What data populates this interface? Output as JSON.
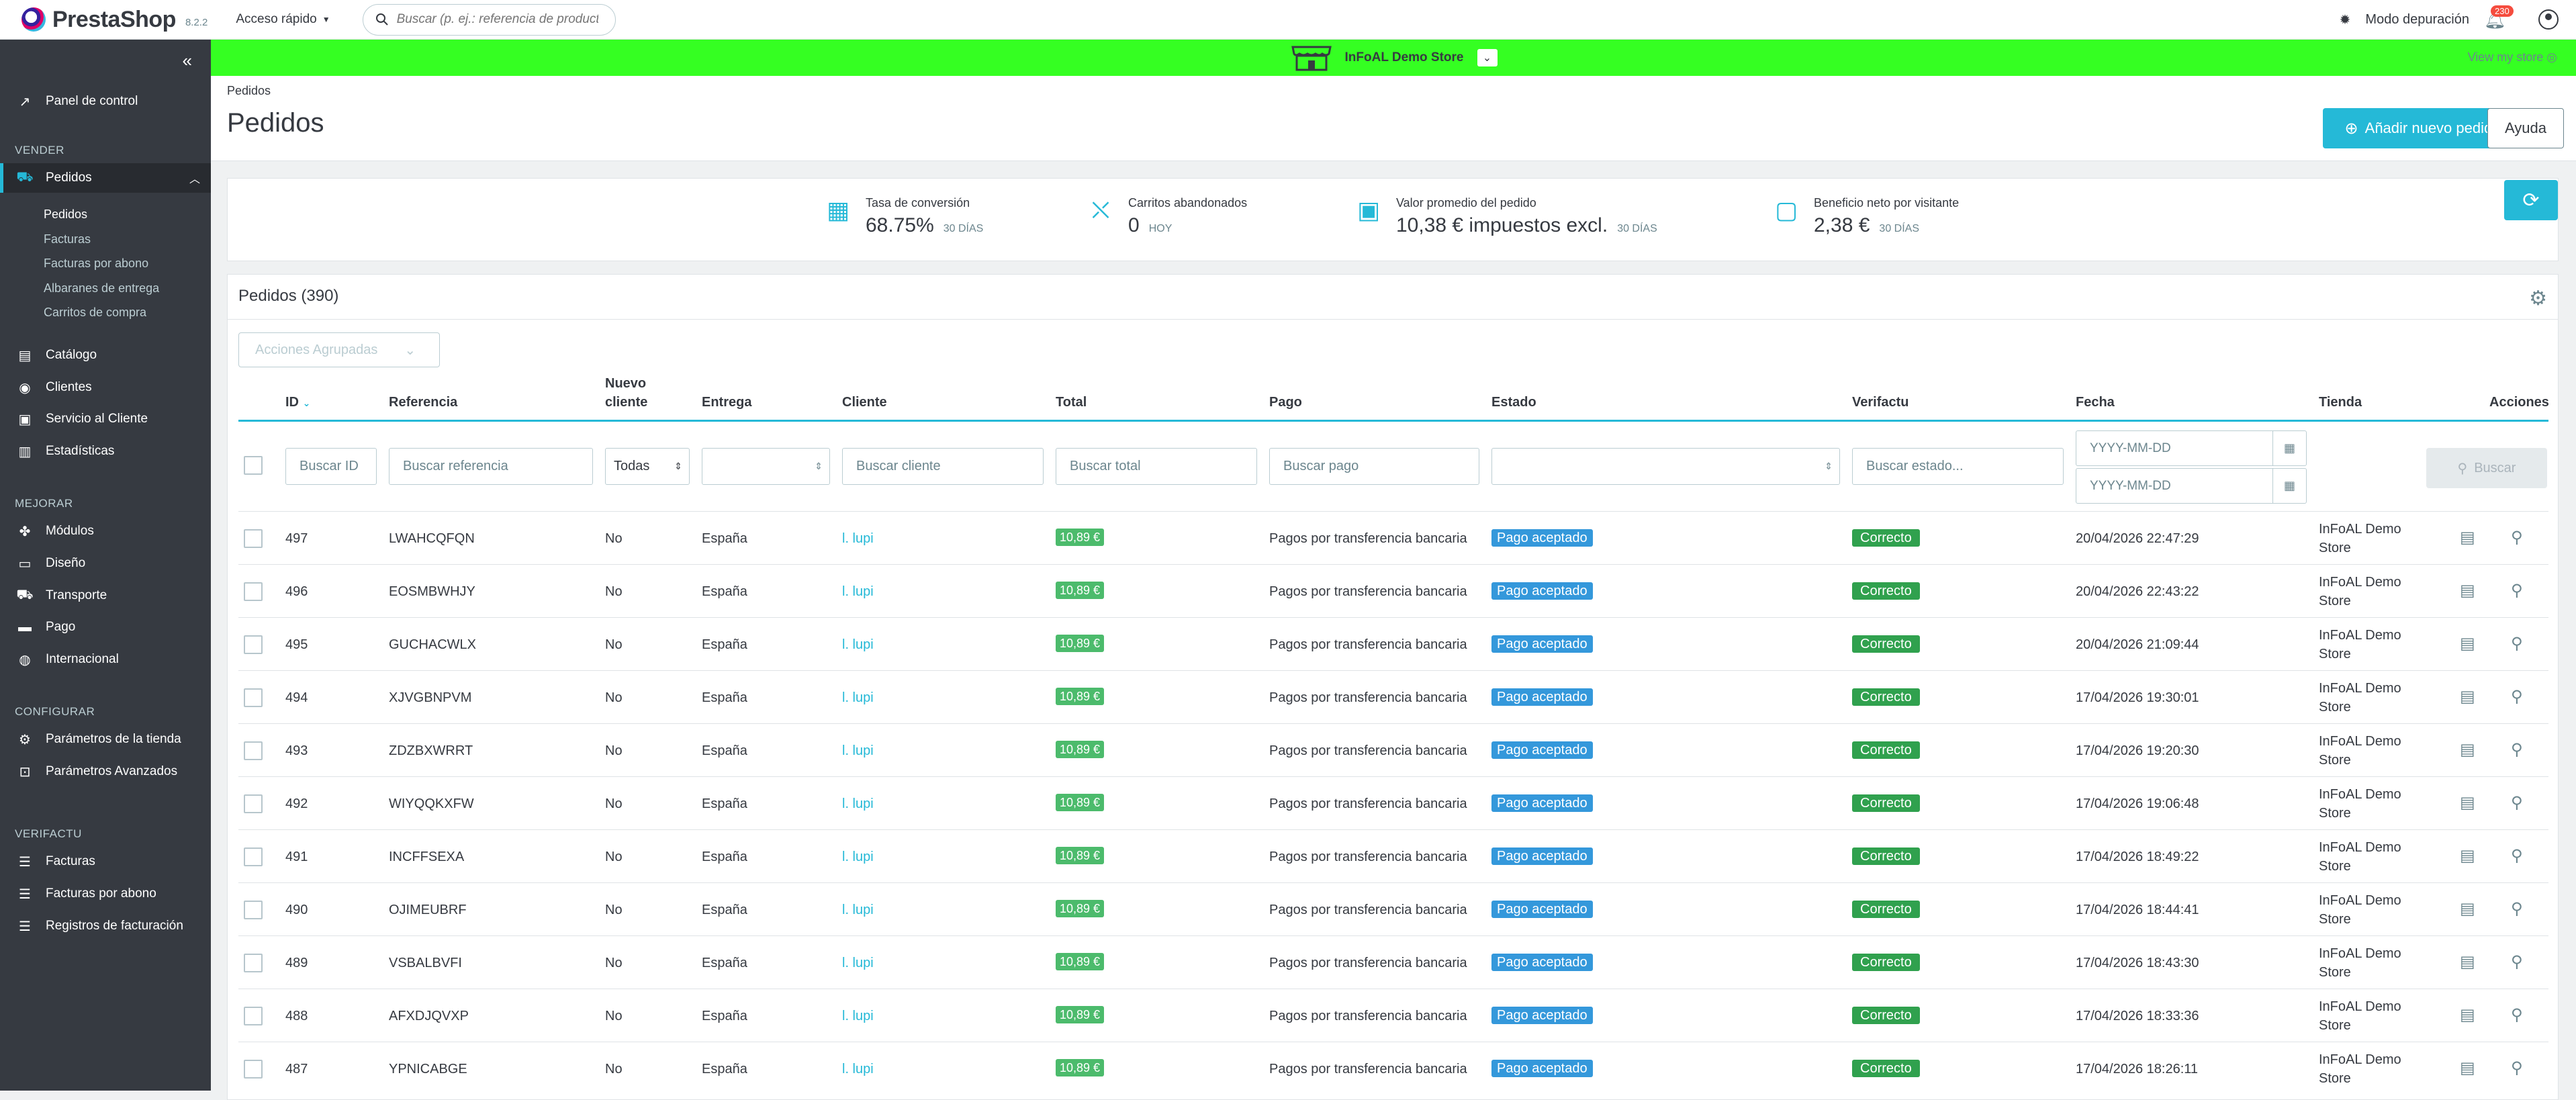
{
  "top": {
    "logo_text": "PrestaShop",
    "version": "8.2.2",
    "quick_access": "Acceso rápido",
    "search_placeholder": "Buscar (p. ej.: referencia de producto, ...",
    "debug_mode": "Modo depuración",
    "notif_count": "230"
  },
  "sidebar": {
    "panel": "Panel de control",
    "sec_sell": "VENDER",
    "orders": "Pedidos",
    "orders_sub": [
      "Pedidos",
      "Facturas",
      "Facturas por abono",
      "Albaranes de entrega",
      "Carritos de compra"
    ],
    "catalog": "Catálogo",
    "customers": "Clientes",
    "service": "Servicio al Cliente",
    "stats": "Estadísticas",
    "sec_improve": "MEJORAR",
    "modules": "Módulos",
    "design": "Diseño",
    "shipping": "Transporte",
    "payment": "Pago",
    "intl": "Internacional",
    "sec_config": "CONFIGURAR",
    "shop_params": "Parámetros de la tienda",
    "adv_params": "Parámetros Avanzados",
    "sec_verifactu": "VERIFACTU",
    "invoices": "Facturas",
    "credit_invoices": "Facturas por abono",
    "billing_logs": "Registros de facturación"
  },
  "store": {
    "name": "InFoAL Demo Store",
    "view": "View my store",
    "color": "#35ff22"
  },
  "header": {
    "breadcrumb": "Pedidos",
    "title": "Pedidos",
    "add_order": "Añadir nuevo pedido",
    "help": "Ayuda"
  },
  "kpi": [
    {
      "label": "Tasa de conversión",
      "value": "68.75%",
      "sub": "30 DÍAS"
    },
    {
      "label": "Carritos abandonados",
      "value": "0",
      "sub": "HOY"
    },
    {
      "label": "Valor promedio del pedido",
      "value": "10,38 € impuestos excl.",
      "sub": "30 DÍAS"
    },
    {
      "label": "Beneficio neto por visitante",
      "value": "2,38 €",
      "sub": "30 DÍAS"
    }
  ],
  "table": {
    "title": "Pedidos (390)",
    "bulk": "Acciones Agrupadas",
    "headers": {
      "id": "ID",
      "ref": "Referencia",
      "new1": "Nuevo",
      "new2": "cliente",
      "delivery": "Entrega",
      "customer": "Cliente",
      "total": "Total",
      "payment": "Pago",
      "state": "Estado",
      "verifactu": "Verifactu",
      "date": "Fecha",
      "shop": "Tienda",
      "actions": "Acciones"
    },
    "filters": {
      "id": "Buscar ID",
      "ref": "Buscar referencia",
      "new": "Todas",
      "customer": "Buscar cliente",
      "total": "Buscar total",
      "payment": "Buscar pago",
      "verifactu": "Buscar estado...",
      "date_from": "YYYY-MM-DD",
      "date_to": "YYYY-MM-DD",
      "search": "Buscar"
    },
    "rows": [
      {
        "id": "497",
        "ref": "LWAHCQFQN",
        "new": "No",
        "delivery": "España",
        "customer": "l. lupi",
        "total": "10,89 €",
        "payment": "Pagos por transferencia bancaria",
        "state": "Pago aceptado",
        "verifactu": "Correcto",
        "date": "20/04/2026 22:47:29",
        "shop1": "InFoAL Demo",
        "shop2": "Store"
      },
      {
        "id": "496",
        "ref": "EOSMBWHJY",
        "new": "No",
        "delivery": "España",
        "customer": "l. lupi",
        "total": "10,89 €",
        "payment": "Pagos por transferencia bancaria",
        "state": "Pago aceptado",
        "verifactu": "Correcto",
        "date": "20/04/2026 22:43:22",
        "shop1": "InFoAL Demo",
        "shop2": "Store"
      },
      {
        "id": "495",
        "ref": "GUCHACWLX",
        "new": "No",
        "delivery": "España",
        "customer": "l. lupi",
        "total": "10,89 €",
        "payment": "Pagos por transferencia bancaria",
        "state": "Pago aceptado",
        "verifactu": "Correcto",
        "date": "20/04/2026 21:09:44",
        "shop1": "InFoAL Demo",
        "shop2": "Store"
      },
      {
        "id": "494",
        "ref": "XJVGBNPVM",
        "new": "No",
        "delivery": "España",
        "customer": "l. lupi",
        "total": "10,89 €",
        "payment": "Pagos por transferencia bancaria",
        "state": "Pago aceptado",
        "verifactu": "Correcto",
        "date": "17/04/2026 19:30:01",
        "shop1": "InFoAL Demo",
        "shop2": "Store"
      },
      {
        "id": "493",
        "ref": "ZDZBXWRRT",
        "new": "No",
        "delivery": "España",
        "customer": "l. lupi",
        "total": "10,89 €",
        "payment": "Pagos por transferencia bancaria",
        "state": "Pago aceptado",
        "verifactu": "Correcto",
        "date": "17/04/2026 19:20:30",
        "shop1": "InFoAL Demo",
        "shop2": "Store"
      },
      {
        "id": "492",
        "ref": "WIYQQKXFW",
        "new": "No",
        "delivery": "España",
        "customer": "l. lupi",
        "total": "10,89 €",
        "payment": "Pagos por transferencia bancaria",
        "state": "Pago aceptado",
        "verifactu": "Correcto",
        "date": "17/04/2026 19:06:48",
        "shop1": "InFoAL Demo",
        "shop2": "Store"
      },
      {
        "id": "491",
        "ref": "INCFFSEXA",
        "new": "No",
        "delivery": "España",
        "customer": "l. lupi",
        "total": "10,89 €",
        "payment": "Pagos por transferencia bancaria",
        "state": "Pago aceptado",
        "verifactu": "Correcto",
        "date": "17/04/2026 18:49:22",
        "shop1": "InFoAL Demo",
        "shop2": "Store"
      },
      {
        "id": "490",
        "ref": "OJIMEUBRF",
        "new": "No",
        "delivery": "España",
        "customer": "l. lupi",
        "total": "10,89 €",
        "payment": "Pagos por transferencia bancaria",
        "state": "Pago aceptado",
        "verifactu": "Correcto",
        "date": "17/04/2026 18:44:41",
        "shop1": "InFoAL Demo",
        "shop2": "Store"
      },
      {
        "id": "489",
        "ref": "VSBALBVFI",
        "new": "No",
        "delivery": "España",
        "customer": "l. lupi",
        "total": "10,89 €",
        "payment": "Pagos por transferencia bancaria",
        "state": "Pago aceptado",
        "verifactu": "Correcto",
        "date": "17/04/2026 18:43:30",
        "shop1": "InFoAL Demo",
        "shop2": "Store"
      },
      {
        "id": "488",
        "ref": "AFXDJQVXP",
        "new": "No",
        "delivery": "España",
        "customer": "l. lupi",
        "total": "10,89 €",
        "payment": "Pagos por transferencia bancaria",
        "state": "Pago aceptado",
        "verifactu": "Correcto",
        "date": "17/04/2026 18:33:36",
        "shop1": "InFoAL Demo",
        "shop2": "Store"
      },
      {
        "id": "487",
        "ref": "YPNICABGE",
        "new": "No",
        "delivery": "España",
        "customer": "l. lupi",
        "total": "10,89 €",
        "payment": "Pagos por transferencia bancaria",
        "state": "Pago aceptado",
        "verifactu": "Correcto",
        "date": "17/04/2026 18:26:11",
        "shop1": "InFoAL Demo",
        "shop2": "Store"
      }
    ]
  }
}
